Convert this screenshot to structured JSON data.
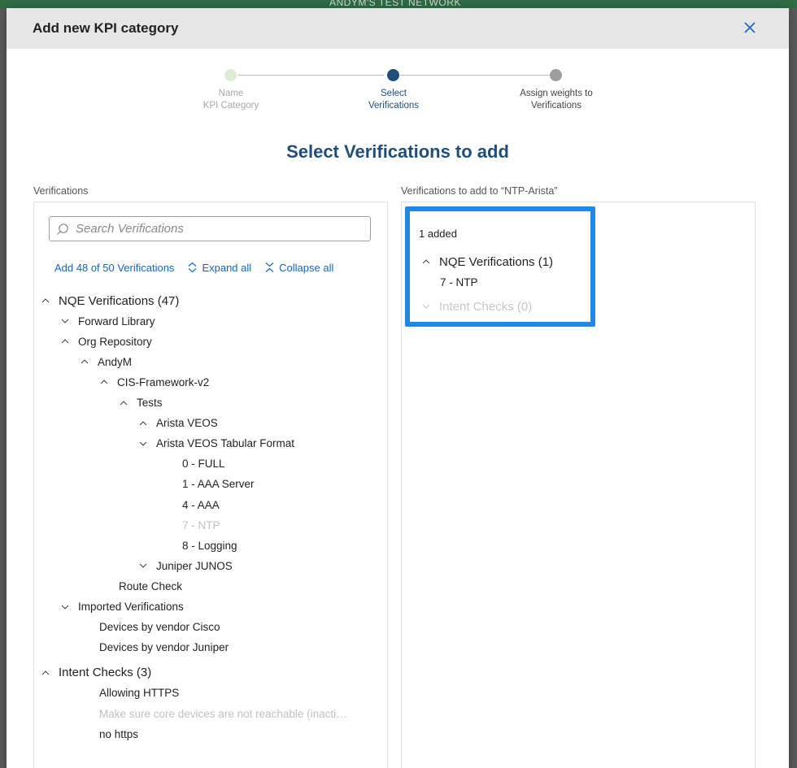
{
  "background": {
    "header_text": "ANDYM'S TEST NETWORK"
  },
  "dialog": {
    "title": "Add new KPI category",
    "close_icon": "close-icon"
  },
  "stepper": {
    "steps": [
      {
        "line1": "Name",
        "line2": "KPI Category",
        "state": "completed",
        "color": "#dcebd3"
      },
      {
        "line1": "Select",
        "line2": "Verifications",
        "state": "active",
        "color": "#1f4e79"
      },
      {
        "line1": "Assign weights to",
        "line2": "Verifications",
        "state": "upcoming",
        "color": "#9e9e9e"
      }
    ]
  },
  "section_title": "Select Verifications to add",
  "left_panel": {
    "label": "Verifications",
    "search": {
      "placeholder": "Search Verifications",
      "value": "",
      "icon": "search-icon"
    },
    "actions": {
      "add_label": "Add 48 of 50 Verifications",
      "expand_label": "Expand all",
      "collapse_label": "Collapse all"
    },
    "tree": [
      {
        "label": "NQE Verifications (47)",
        "level": 0,
        "chevron": "up",
        "big": true,
        "disabled": false
      },
      {
        "label": "Forward Library",
        "level": 1,
        "chevron": "down",
        "big": false,
        "disabled": false
      },
      {
        "label": "Org Repository",
        "level": 1,
        "chevron": "up",
        "big": false,
        "disabled": false
      },
      {
        "label": "AndyM",
        "level": 2,
        "chevron": "up",
        "big": false,
        "disabled": false
      },
      {
        "label": "CIS-Framework-v2",
        "level": 3,
        "chevron": "up",
        "big": false,
        "disabled": false
      },
      {
        "label": "Tests",
        "level": 4,
        "chevron": "up",
        "big": false,
        "disabled": false
      },
      {
        "label": "Arista VEOS",
        "level": 5,
        "chevron": "up",
        "big": false,
        "disabled": false
      },
      {
        "label": "Arista VEOS Tabular Format",
        "level": 5,
        "chevron": "down",
        "big": false,
        "disabled": false
      },
      {
        "label": "0 - FULL",
        "level": 6,
        "chevron": "none",
        "big": false,
        "disabled": false
      },
      {
        "label": "1 - AAA Server",
        "level": 6,
        "chevron": "none",
        "big": false,
        "disabled": false
      },
      {
        "label": "4 - AAA",
        "level": 6,
        "chevron": "none",
        "big": false,
        "disabled": false
      },
      {
        "label": "7 - NTP",
        "level": 6,
        "chevron": "none",
        "big": false,
        "disabled": true
      },
      {
        "label": "8 - Logging",
        "level": 6,
        "chevron": "none",
        "big": false,
        "disabled": false
      },
      {
        "label": "Juniper JUNOS",
        "level": 5,
        "chevron": "down",
        "big": false,
        "disabled": false
      },
      {
        "label": "Route Check",
        "level": 3,
        "chevron": "none",
        "big": false,
        "disabled": false
      },
      {
        "label": "Imported Verifications",
        "level": 1,
        "chevron": "down",
        "big": false,
        "disabled": false
      },
      {
        "label": "Devices by vendor Cisco",
        "level": 2,
        "chevron": "none",
        "big": false,
        "disabled": false
      },
      {
        "label": "Devices by vendor Juniper",
        "level": 2,
        "chevron": "none",
        "big": false,
        "disabled": false
      },
      {
        "label": "Intent Checks (3)",
        "level": 0,
        "chevron": "up",
        "big": true,
        "disabled": false
      },
      {
        "label": "Allowing HTTPS",
        "level": 2,
        "chevron": "none",
        "big": false,
        "disabled": false
      },
      {
        "label": "Make sure core devices are not reachable (inacti…",
        "level": 2,
        "chevron": "none",
        "big": false,
        "disabled": true
      },
      {
        "label": "no https",
        "level": 2,
        "chevron": "none",
        "big": false,
        "disabled": false
      }
    ]
  },
  "right_panel": {
    "label": "Verifications to add to “NTP-Arista”",
    "added_count": "1 added",
    "groups": [
      {
        "label": "NQE Verifications (1)",
        "chevron": "up",
        "disabled": false,
        "items": [
          "7 - NTP"
        ]
      },
      {
        "label": "Intent Checks (0)",
        "chevron": "down",
        "disabled": true,
        "items": []
      }
    ]
  },
  "colors": {
    "accent_blue": "#1e88e5",
    "title_blue": "#1f4e79",
    "link_blue": "#1565c0",
    "disabled_gray": "#c0c0c0"
  }
}
